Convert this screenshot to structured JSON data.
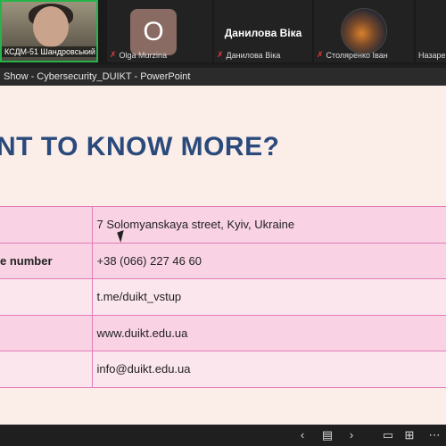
{
  "participants": [
    {
      "name": "КСДМ-51 Шандровський ...",
      "muted": false
    },
    {
      "name": "Olga Murzina",
      "initial": "O",
      "muted": true
    },
    {
      "name": "Данилова Віка",
      "display": "Данилова Віка",
      "muted": true
    },
    {
      "name": "Столяренко Іван",
      "muted": true
    },
    {
      "name": "Назаре",
      "muted": false
    }
  ],
  "titlebar": {
    "text": "Show  -  Cybersecurity_DUIKT  -  PowerPoint"
  },
  "slide": {
    "title": "NT TO KNOW MORE?",
    "rows": [
      {
        "label": "",
        "value": "7 Solomyanskaya street, Kyiv, Ukraine"
      },
      {
        "label": "e number",
        "value": "+38 (066) 227 46 60"
      },
      {
        "label": "",
        "value": "t.me/duikt_vstup"
      },
      {
        "label": "",
        "value": "www.duikt.edu.ua"
      },
      {
        "label": "",
        "value": "info@duikt.edu.ua"
      }
    ]
  },
  "controls": {
    "prev": "‹",
    "grid": "▤",
    "next": "›",
    "view": "▭",
    "fit": "⊞",
    "more": "⋯"
  },
  "icons": {
    "mic_muted": "mic-off-icon"
  },
  "colors": {
    "title": "#2a4a7c",
    "row_dark": "#f9d3e4",
    "row_light": "#fce6ee",
    "border": "#e27bb8",
    "speaker_border": "#26b34a"
  }
}
